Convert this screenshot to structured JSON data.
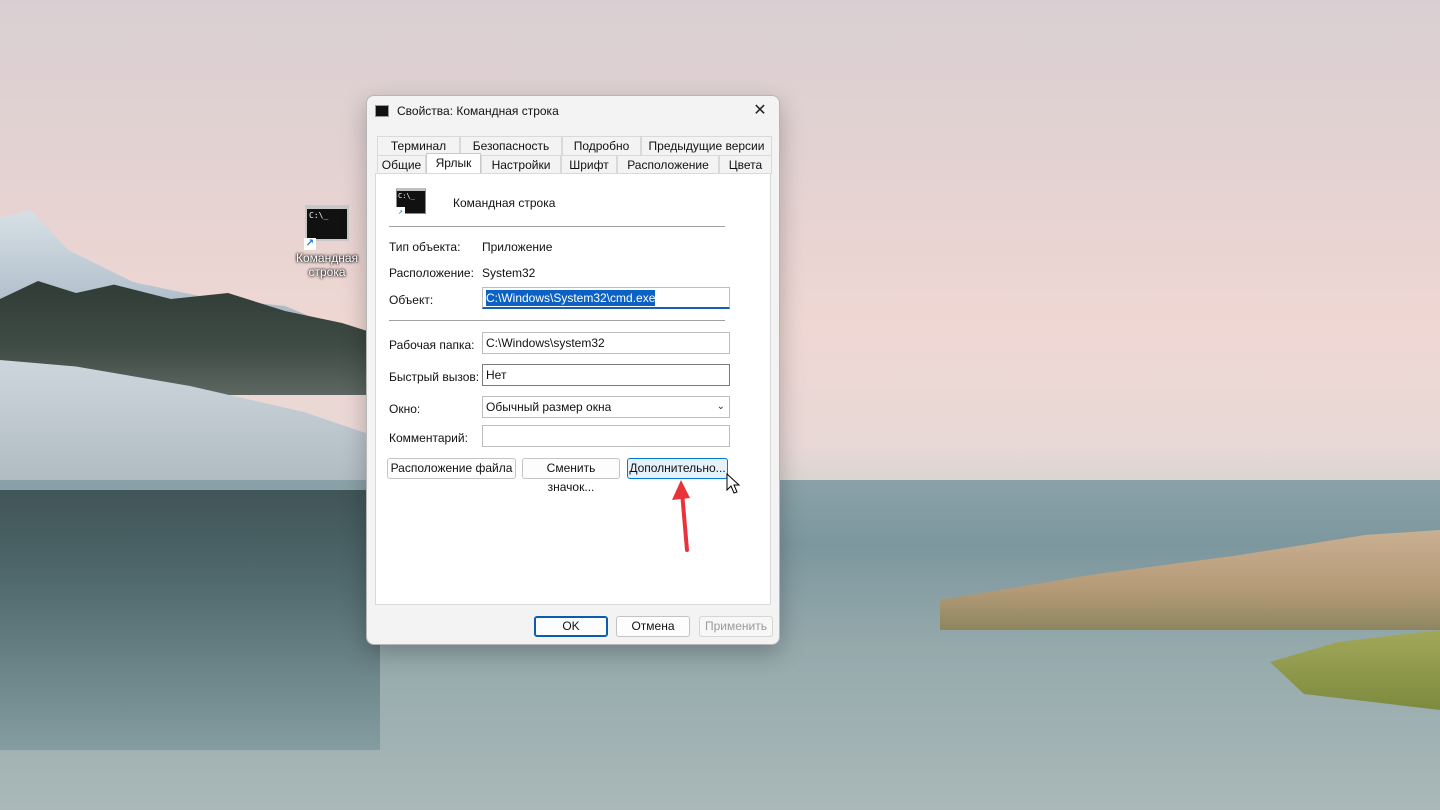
{
  "desktop": {
    "icon_label": "Командная строка"
  },
  "dialog": {
    "title": "Свойства: Командная строка",
    "close_glyph": "✕",
    "tabs_row1": [
      "Терминал",
      "Безопасность",
      "Подробно",
      "Предыдущие версии"
    ],
    "tabs_row2": [
      "Общие",
      "Ярлык",
      "Настройки",
      "Шрифт",
      "Расположение",
      "Цвета"
    ],
    "active_tab": "Ярлык",
    "shortcut_name": "Командная строка",
    "icon_text": "C:\\_",
    "type_label": "Тип объекта:",
    "type_value": "Приложение",
    "location_label": "Расположение:",
    "location_value": "System32",
    "target_label": "Объект:",
    "target_value": "C:\\Windows\\System32\\cmd.exe",
    "workdir_label": "Рабочая папка:",
    "workdir_value": "C:\\Windows\\system32",
    "hotkey_label": "Быстрый вызов:",
    "hotkey_value": "Нет",
    "window_label": "Окно:",
    "window_value": "Обычный размер окна",
    "comment_label": "Комментарий:",
    "comment_value": "",
    "btn_file_location": "Расположение файла",
    "btn_change_icon": "Сменить значок...",
    "btn_advanced": "Дополнительно...",
    "btn_ok": "OK",
    "btn_cancel": "Отмена",
    "btn_apply": "Применить"
  },
  "colors": {
    "annotation_arrow": "#e8333a",
    "selection": "#0b62c4"
  }
}
